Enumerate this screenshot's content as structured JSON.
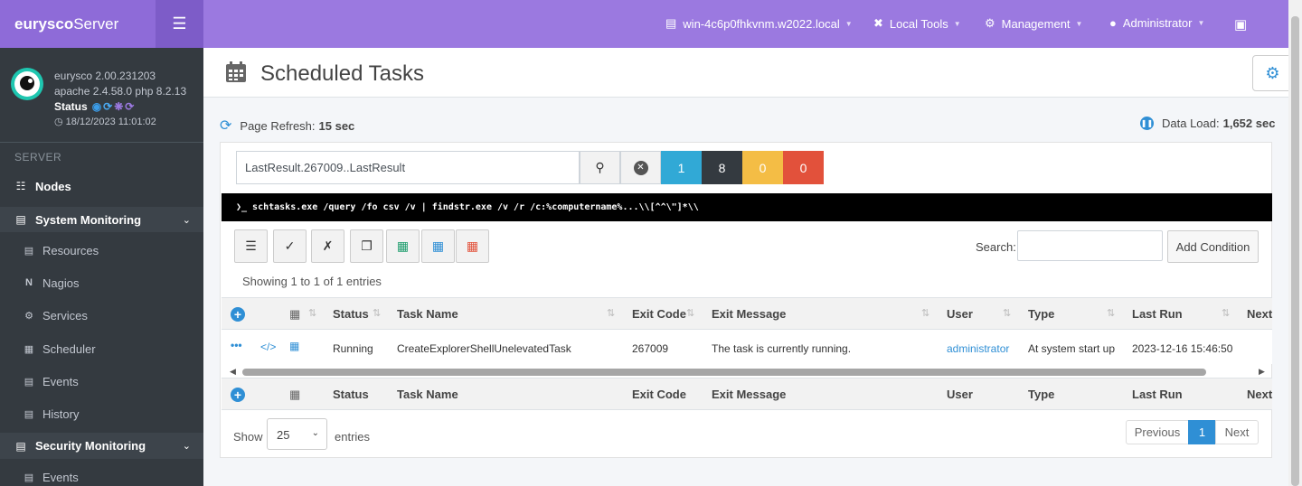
{
  "brand": {
    "name_bold": "eurysco",
    "name_rest": "Server"
  },
  "user_panel": {
    "version": "eurysco 2.00.231203",
    "stack": "apache 2.4.58.0  php 8.2.13",
    "status_label": "Status",
    "datetime": "18/12/2023 11:01:02"
  },
  "sidebar": {
    "section": "SERVER",
    "nodes": "Nodes",
    "system_monitoring": "System Monitoring",
    "sys_items": [
      "Resources",
      "Nagios",
      "Services",
      "Scheduler",
      "Events",
      "History"
    ],
    "security_monitoring": "Security Monitoring",
    "sec_items": [
      "Events"
    ]
  },
  "topbar": {
    "host": "win-4c6p0fhkvnm.w2022.local",
    "local_tools": "Local Tools",
    "management": "Management",
    "user": "Administrator"
  },
  "page": {
    "title": "Scheduled Tasks",
    "refresh_label": "Page Refresh:",
    "refresh_value": "15 sec",
    "load_label": "Data Load:",
    "load_value": "1,652 sec"
  },
  "filter": {
    "value": "LastResult.267009..LastResult",
    "counts": [
      "1",
      "8",
      "0",
      "0"
    ]
  },
  "command": "❯_  schtasks.exe /query /fo csv /v | findstr.exe /v /r /c:%computername%...\\\\[^^\\\"]*\\\\",
  "table": {
    "search_label": "Search:",
    "add_condition": "Add Condition",
    "info": "Showing 1 to 1 of 1 entries",
    "headers": [
      "Status",
      "Task Name",
      "Exit Code",
      "Exit Message",
      "User",
      "Type",
      "Last Run",
      "Next"
    ],
    "row": {
      "status": "Running",
      "task_name": "CreateExplorerShellUnelevatedTask",
      "exit_code": "267009",
      "exit_message": "The task is currently running.",
      "user": "administrator",
      "type": "At system start up",
      "last_run": "2023-12-16 15:46:50"
    },
    "show_label": "Show",
    "page_size": "25",
    "entries_label": "entries",
    "prev": "Previous",
    "page": "1",
    "next": "Next"
  },
  "colors": {
    "brand": "#8e6bd8",
    "topbar": "#9b79e0",
    "info": "#2f8fd5",
    "dark": "#343a40",
    "warning": "#f4bd45",
    "danger": "#e2513b",
    "cyan": "#31a9d6"
  }
}
